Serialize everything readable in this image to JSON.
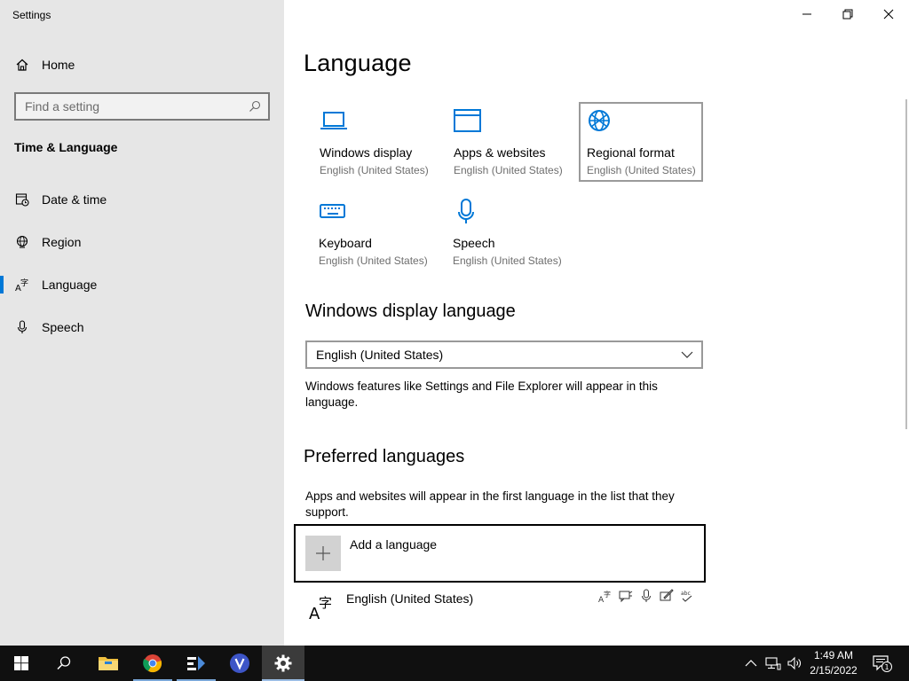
{
  "window": {
    "title": "Settings",
    "controls": {
      "minimize": "minimize",
      "restore": "restore",
      "close": "close"
    }
  },
  "sidebar": {
    "home_label": "Home",
    "search_placeholder": "Find a setting",
    "section_title": "Time & Language",
    "items": [
      {
        "label": "Date & time",
        "icon": "calendar-clock-icon"
      },
      {
        "label": "Region",
        "icon": "globe-icon"
      },
      {
        "label": "Language",
        "icon": "language-icon",
        "active": true
      },
      {
        "label": "Speech",
        "icon": "microphone-icon"
      }
    ]
  },
  "main": {
    "title": "Language",
    "tiles": [
      {
        "title": "Windows display",
        "subtitle": "English (United States)",
        "icon": "laptop-icon"
      },
      {
        "title": "Apps & websites",
        "subtitle": "English (United States)",
        "icon": "browser-window-icon"
      },
      {
        "title": "Regional format",
        "subtitle": "English (United States)",
        "icon": "globe-settings-icon",
        "selected": true
      },
      {
        "title": "Keyboard",
        "subtitle": "English (United States)",
        "icon": "keyboard-icon"
      },
      {
        "title": "Speech",
        "subtitle": "English (United States)",
        "icon": "microphone-icon"
      }
    ],
    "display_language": {
      "heading": "Windows display language",
      "selected": "English (United States)",
      "description": "Windows features like Settings and File Explorer will appear in this language."
    },
    "preferred": {
      "heading": "Preferred languages",
      "description": "Apps and websites will appear in the first language in the list that they support.",
      "add_label": "Add a language",
      "languages": [
        {
          "name": "English (United States)",
          "features": [
            "display-language-icon",
            "text-to-speech-icon",
            "speech-recognition-icon",
            "handwriting-icon",
            "spell-check-icon"
          ]
        }
      ]
    }
  },
  "taskbar": {
    "apps": [
      "start-button",
      "search-button",
      "file-explorer",
      "chrome",
      "app-arrow",
      "app-v",
      "settings"
    ],
    "clock_time": "1:49 AM",
    "clock_date": "2/15/2022",
    "notification_count": "1"
  },
  "colors": {
    "accent": "#0078d7",
    "sidebar_bg": "#e6e6e6",
    "taskbar_bg": "#101010"
  }
}
